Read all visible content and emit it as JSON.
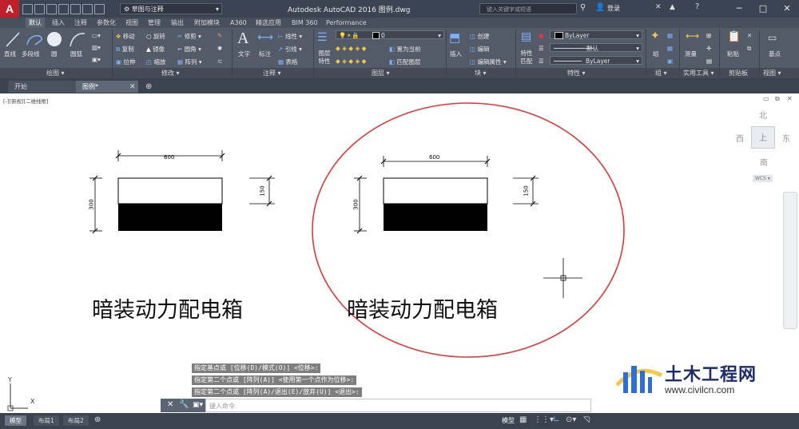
{
  "titlebar": {
    "workspace": "草图与注释",
    "app_title": "Autodesk AutoCAD 2016    图例.dwg",
    "search_placeholder": "键入关键字或短语",
    "login": "登录"
  },
  "ribbon_tabs": [
    "默认",
    "插入",
    "注释",
    "参数化",
    "视图",
    "管理",
    "输出",
    "附加模块",
    "A360",
    "精选应用",
    "BIM 360",
    "Performance"
  ],
  "panels": {
    "draw": {
      "label": "绘图 ▾",
      "line": "直线",
      "polyline": "多段线",
      "circle": "圆",
      "arc": "圆弧"
    },
    "modify": {
      "label": "修改 ▾",
      "move": "移动",
      "rotate": "旋转",
      "trim": "修剪",
      "copy": "复制",
      "mirror": "镜像",
      "fillet": "圆角",
      "stretch": "拉伸",
      "scale": "缩放",
      "array": "阵列"
    },
    "annotation": {
      "label": "注释 ▾",
      "text": "文字",
      "dimension": "标注",
      "linear": "线性",
      "leader": "引线",
      "table": "表格"
    },
    "layers": {
      "label": "图层 ▾",
      "layer_props": "图层特性",
      "current_layer": "0",
      "make_current": "置为当前",
      "match_layer": "匹配图层"
    },
    "block": {
      "label": "块 ▾",
      "insert": "插入",
      "create": "创建",
      "edit": "编辑",
      "edit_attr": "编辑属性"
    },
    "properties": {
      "label": "特性 ▾",
      "match": "特性匹配",
      "color": "ByLayer",
      "linetype": "默认",
      "lineweight": "ByLayer"
    },
    "groups": {
      "label": "组 ▾",
      "group": "组"
    },
    "utilities": {
      "label": "实用工具 ▾",
      "measure": "测量"
    },
    "clipboard": {
      "label": "剪贴板",
      "paste": "粘贴"
    },
    "view": {
      "label": "视图 ▾",
      "base": "基点"
    }
  },
  "doc_tabs": [
    "开始",
    "图例*"
  ],
  "viewport_label": "[-][俯视][二维线框]",
  "viewcube": {
    "north": "北",
    "south": "南",
    "west": "西",
    "east": "东",
    "top": "上",
    "wcs": "WCS ▾"
  },
  "drawing": {
    "left": {
      "width_dim": "600",
      "height_dim": "300",
      "fill_dim": "150",
      "caption": "暗装动力配电箱"
    },
    "right": {
      "width_dim": "600",
      "height_dim": "300",
      "fill_dim": "150",
      "caption": "暗装动力配电箱"
    }
  },
  "command_history": [
    "指定基点或 [位移(D)/模式(O)] <位移>:",
    "指定第二个点或 [阵列(A)] <使用第一个点作为位移>:",
    "指定第二个点或 [阵列(A)/退出(E)/放弃(U)] <退出>:"
  ],
  "command_input": {
    "placeholder": "键入命令"
  },
  "ucs": {
    "x": "X",
    "y": "Y"
  },
  "layout_tabs": [
    "模型",
    "布局1",
    "布局2"
  ],
  "status": {
    "model": "模型"
  },
  "watermark": {
    "title": "土木工程网",
    "url": "www.civilcn.com"
  },
  "colors": {
    "accent_red": "#e0373a",
    "titlebar": "#3b4453",
    "ribbon": "#535b68"
  }
}
